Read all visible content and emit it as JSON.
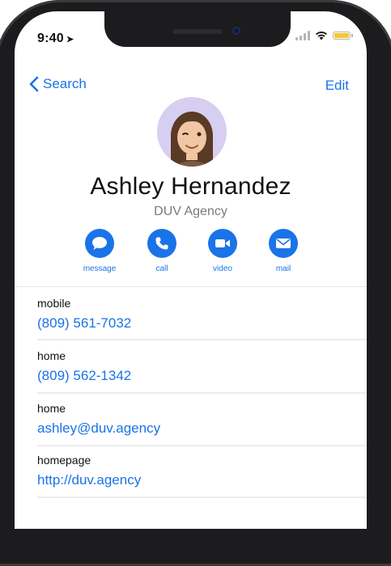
{
  "status_bar": {
    "time": "9:40",
    "location_glyph": "➤"
  },
  "nav": {
    "back_label": "Search",
    "edit_label": "Edit"
  },
  "contact": {
    "name": "Ashley Hernandez",
    "company": "DUV Agency",
    "avatar_icon": "memoji-avatar-icon"
  },
  "actions": [
    {
      "label": "message",
      "icon": "message-icon"
    },
    {
      "label": "call",
      "icon": "phone-icon"
    },
    {
      "label": "video",
      "icon": "video-icon"
    },
    {
      "label": "mail",
      "icon": "mail-icon"
    }
  ],
  "fields": [
    {
      "label": "mobile",
      "value": "(809) 561-7032"
    },
    {
      "label": "home",
      "value": "(809) 562-1342"
    },
    {
      "label": "home",
      "value": "ashley@duv.agency"
    },
    {
      "label": "homepage",
      "value": "http://duv.agency"
    }
  ],
  "colors": {
    "accent": "#1a73e8",
    "avatar_bg": "#d6cff2",
    "battery": "#f7c82e",
    "frame": "#1c1c1e"
  }
}
